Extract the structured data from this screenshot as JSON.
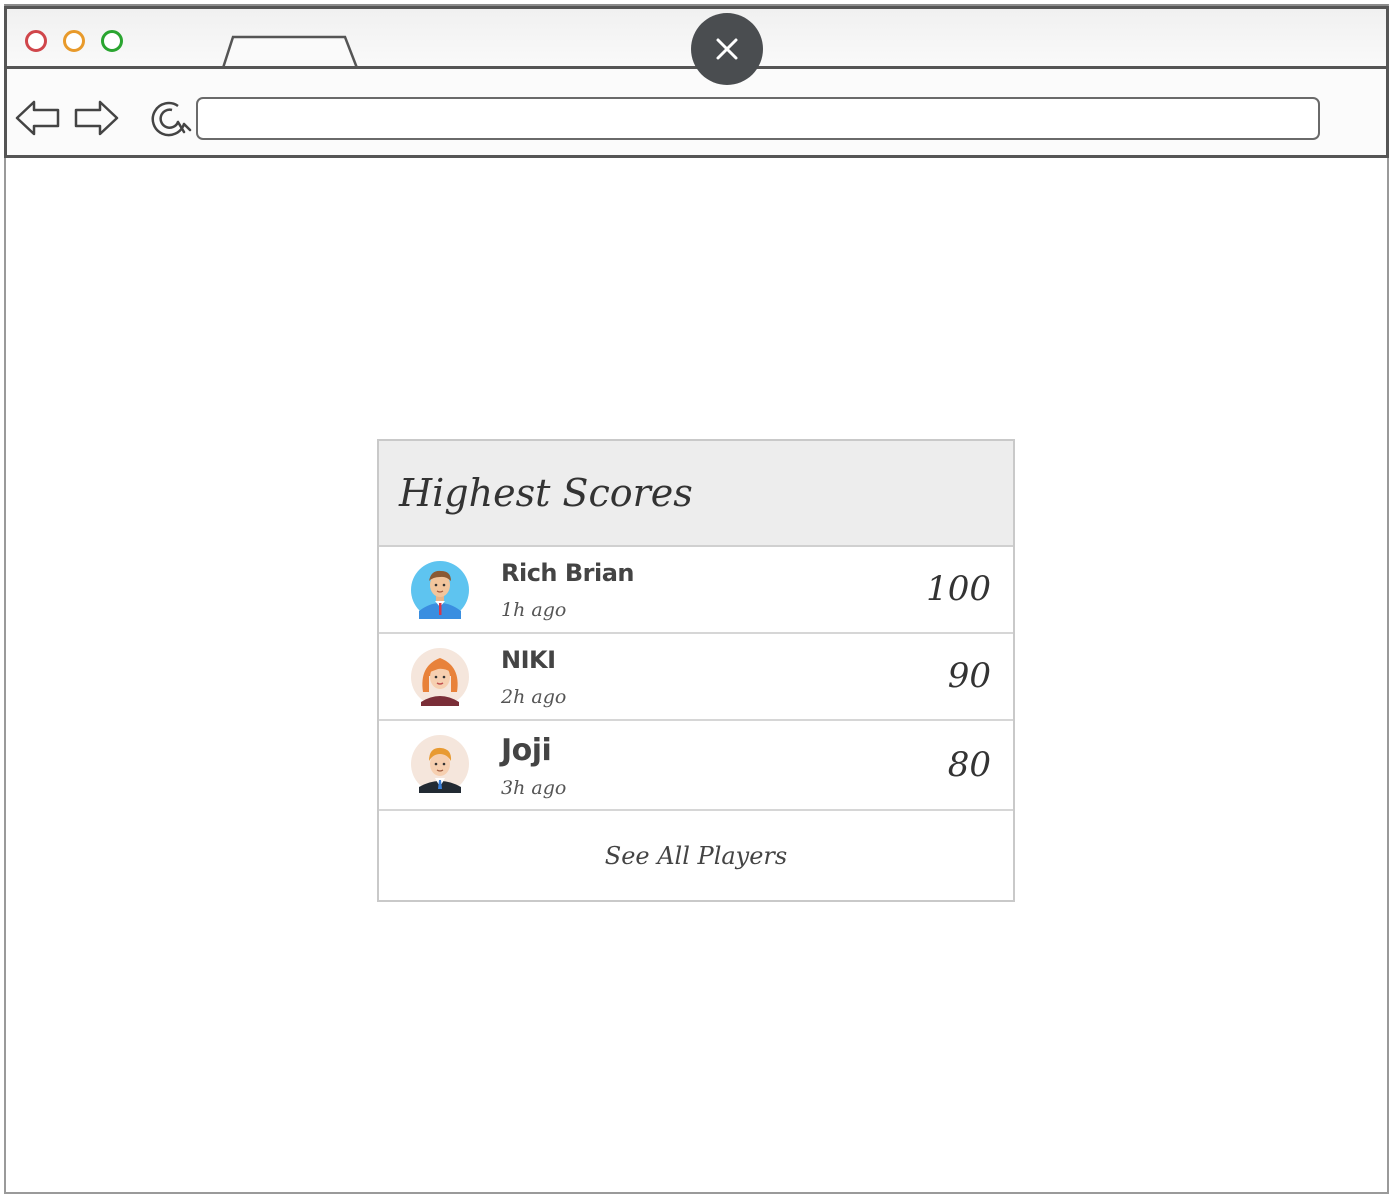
{
  "browser": {
    "window_controls": [
      {
        "name": "close",
        "color": "#d0464b"
      },
      {
        "name": "minimize",
        "color": "#e89a2b"
      },
      {
        "name": "maximize",
        "color": "#2aa530"
      }
    ],
    "tab_title": "",
    "url": "",
    "overlay_close_symbol": "×"
  },
  "card": {
    "title": "Highest Scores",
    "players": [
      {
        "name": "Rich Brian",
        "time": "1h ago",
        "score": "100",
        "avatar": "man-blue-shirt-avatar"
      },
      {
        "name": "NIKI",
        "time": "2h ago",
        "score": "90",
        "avatar": "woman-red-hair-avatar"
      },
      {
        "name": "Joji",
        "time": "3h ago",
        "score": "80",
        "avatar": "man-suit-avatar"
      }
    ],
    "see_all_label": "See All Players"
  },
  "colors": {
    "header_bg": "#ededed",
    "close_overlay": "#4a4d50"
  }
}
